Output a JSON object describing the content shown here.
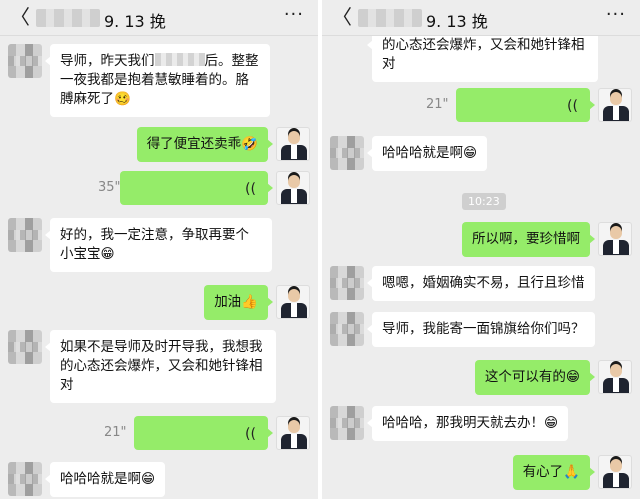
{
  "left": {
    "header": {
      "title": "9. 13 挽",
      "back_glyph": "〈",
      "more_glyph": "···"
    },
    "messages": [
      {
        "side": "other",
        "text": "导师，昨天我们",
        "text2": "后。整整一夜我都是抱着慧敏睡着的。胳膊麻死了🥴"
      },
      {
        "side": "self",
        "text": "得了便宜还卖乖🤣"
      },
      {
        "side": "self",
        "voice": true,
        "duration": "35\""
      },
      {
        "side": "other",
        "text": "好的，我一定注意，争取再要个小宝宝😁"
      },
      {
        "side": "self",
        "text": "加油👍"
      },
      {
        "side": "other",
        "text": "如果不是导师及时开导我，我想我的心态还会爆炸，又会和她针锋相对"
      },
      {
        "side": "self",
        "voice": true,
        "duration": "21\""
      },
      {
        "side": "other",
        "text": "哈哈哈就是啊😁"
      }
    ]
  },
  "right": {
    "header": {
      "title": "9. 13 挽",
      "back_glyph": "〈",
      "more_glyph": "···"
    },
    "messages": [
      {
        "side": "other",
        "text": "的心态还会爆炸，又会和她针锋相对"
      },
      {
        "side": "self",
        "voice": true,
        "duration": "21\""
      },
      {
        "side": "other",
        "text": "哈哈哈就是啊😁"
      },
      {
        "timestamp": "10:23"
      },
      {
        "side": "self",
        "text": "所以啊，要珍惜啊"
      },
      {
        "side": "other",
        "text": "嗯嗯，婚姻确实不易，且行且珍惜"
      },
      {
        "side": "other",
        "text": "导师，我能寄一面锦旗给你们吗？"
      },
      {
        "side": "self",
        "text": "这个可以有的😁"
      },
      {
        "side": "other",
        "text": "哈哈哈，那我明天就去办！😁"
      },
      {
        "side": "self",
        "text": "有心了🙏"
      }
    ]
  },
  "voice_icon": "))",
  "colors": {
    "self_bubble": "#95ec69",
    "other_bubble": "#ffffff",
    "background": "#ededed"
  }
}
